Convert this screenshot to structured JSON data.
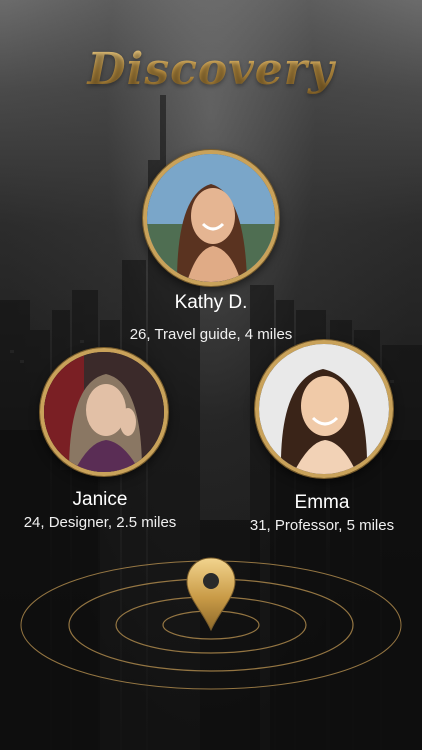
{
  "app": {
    "title": "Discovery"
  },
  "profiles": [
    {
      "name": "Kathy D.",
      "details": "26, Travel guide, 4 miles"
    },
    {
      "name": "Janice",
      "details": "24, Designer, 2.5 miles"
    },
    {
      "name": "Emma",
      "details": "31, Professor, 5 miles"
    }
  ],
  "icons": {
    "location": "location-pin-icon"
  },
  "colors": {
    "accent_gold": "#c9a25a",
    "text": "#ffffff",
    "background": "#1a1a1a"
  }
}
